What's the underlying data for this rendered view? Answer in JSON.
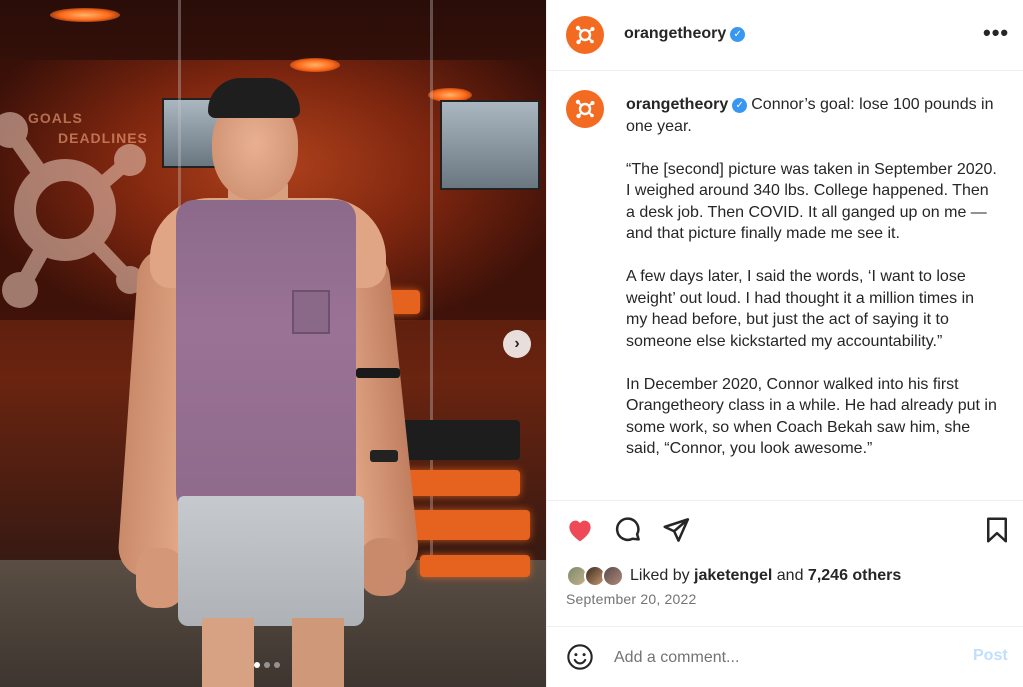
{
  "post": {
    "username": "orangetheory",
    "verified_mark": "✓",
    "more_icon": "more-icon",
    "more_glyph": "•••"
  },
  "media": {
    "slogan_line1": "GOALS",
    "slogan_line2": "DEADLINES",
    "slide_count": 3,
    "active_slide": 1,
    "next_glyph": "›"
  },
  "caption": {
    "username": "orangetheory",
    "paragraphs": [
      "Connor’s goal: lose 100 pounds in one year.",
      "“The [second] picture was taken in September 2020. I weighed around 340 lbs. College happened. Then a desk job. Then COVID. It all ganged up on me — and that picture finally made me see it.",
      "A few days later, I said the words, ‘I want to lose weight’ out loud. I had thought it a million times in my head before, but just the act of saying it to someone else kickstarted my accountability.”",
      "In December 2020, Connor walked into his first Orangetheory class in a while. He had already put in some work, so when Coach Bekah saw him, she said, “Connor, you look awesome.”"
    ]
  },
  "actions": {
    "icons": [
      "heart-filled-icon",
      "comment-icon",
      "share-icon",
      "bookmark-icon"
    ],
    "liked": true
  },
  "likes": {
    "prefix": "Liked by",
    "user": "jaketengel",
    "and": "and",
    "others": "7,246 others"
  },
  "date": "September 20, 2022",
  "comment": {
    "placeholder": "Add a comment...",
    "post_label": "Post"
  },
  "colors": {
    "brand_orange": "#f26b21",
    "like_red": "#ed4956",
    "verified_blue": "#3897f0",
    "post_disabled": "#c0dffd"
  }
}
